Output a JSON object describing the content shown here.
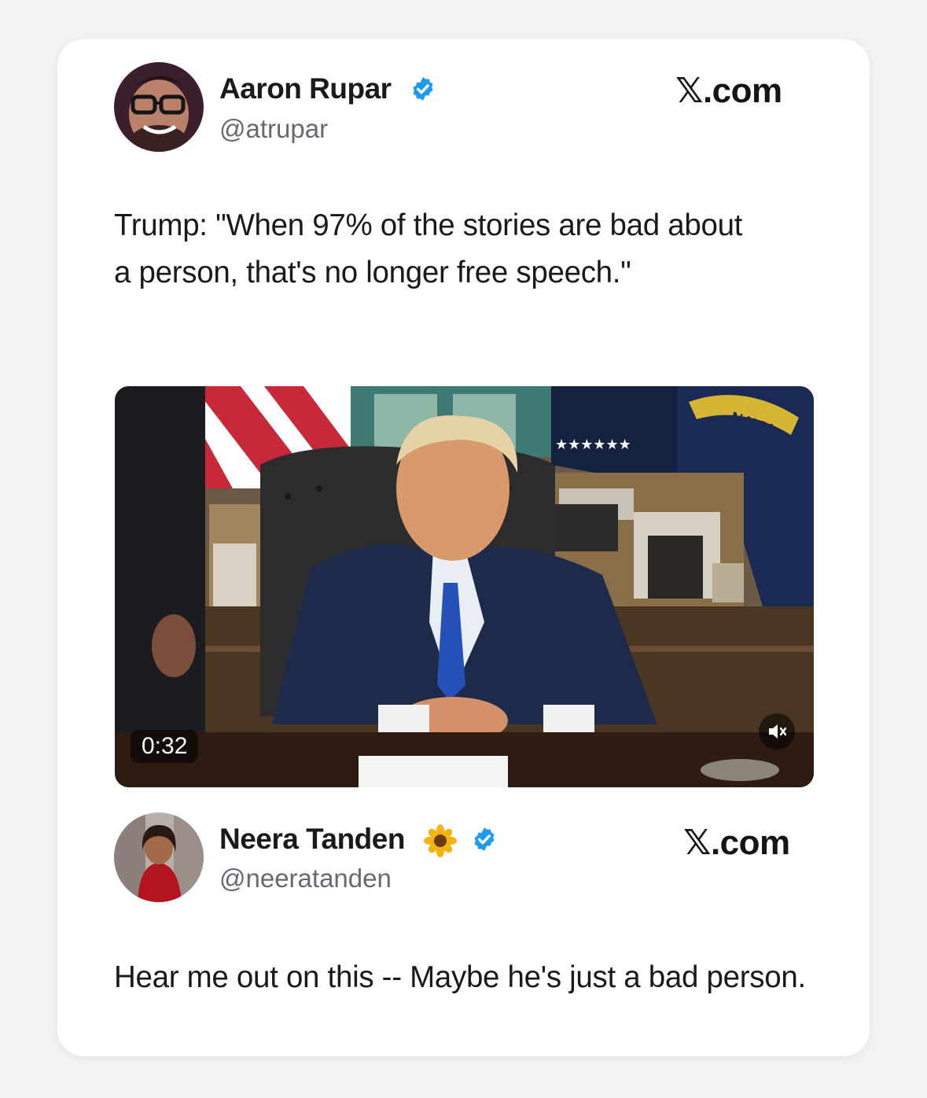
{
  "tweet1": {
    "author_name": "Aaron Rupar",
    "author_handle": "@atrupar",
    "source_label": "𝕏.com",
    "text": "Trump: \"When 97% of the stories are bad about a person, that's no longer free speech.\"",
    "video": {
      "duration": "0:32",
      "flag_text": "NAVY"
    }
  },
  "tweet2": {
    "author_name": "Neera Tanden",
    "author_handle": "@neeratanden",
    "source_label": "𝕏.com",
    "text": "Hear me out on this -- Maybe he's just a bad person."
  },
  "colors": {
    "verified_blue": "#1d9bf0",
    "card_bg": "#ffffff",
    "page_bg": "#f2f2f4"
  },
  "icons": {
    "verified": "verified-badge-icon",
    "sunflower": "sunflower-emoji-icon",
    "mute": "speaker-muted-icon"
  }
}
